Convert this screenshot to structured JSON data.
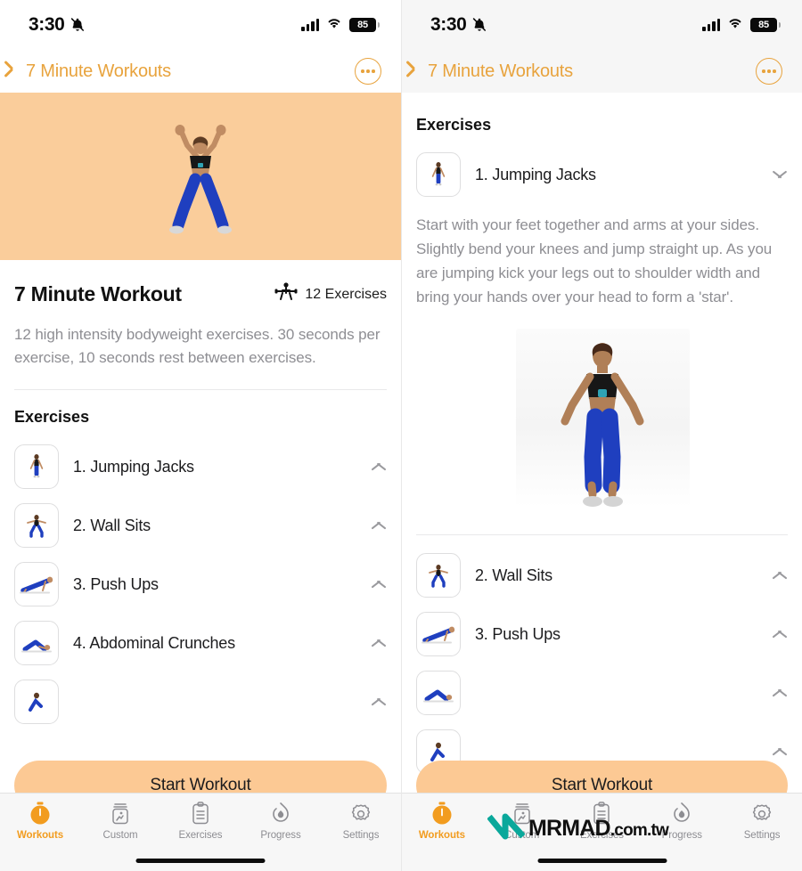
{
  "status": {
    "time": "3:30",
    "bell_icon": "bell-slash-icon",
    "signal_icon": "cellular-signal-icon",
    "wifi_icon": "wifi-icon",
    "battery_level": "85"
  },
  "nav": {
    "back_icon": "chevron-left-icon",
    "back_title": "7 Minute Workouts",
    "more_icon": "ellipsis-circle-icon"
  },
  "left": {
    "hero_bg": "#facd9b",
    "hero_icon": "jumping-jacks-photo",
    "workout_title": "7 Minute Workout",
    "count_icon": "weightlifter-icon",
    "count_label": "12 Exercises",
    "description": "12 high intensity bodyweight exercises. 30 seconds per exercise, 10 seconds rest between exercises.",
    "section_title": "Exercises",
    "exercises": [
      {
        "label": "1. Jumping Jacks",
        "chevron": "chevron-up-icon",
        "thumb": "jumping-jacks-thumb"
      },
      {
        "label": "2. Wall Sits",
        "chevron": "chevron-up-icon",
        "thumb": "wall-sits-thumb"
      },
      {
        "label": "3. Push Ups",
        "chevron": "chevron-up-icon",
        "thumb": "push-ups-thumb"
      },
      {
        "label": "4. Abdominal Crunches",
        "chevron": "chevron-up-icon",
        "thumb": "abdominal-crunches-thumb"
      }
    ],
    "start_label": "Start Workout"
  },
  "right": {
    "section_title": "Exercises",
    "expanded": {
      "label": "1. Jumping Jacks",
      "chevron": "chevron-down-icon",
      "thumb": "jumping-jacks-thumb",
      "description": "Start with your feet together and arms at your sides. Slightly bend your knees and jump straight up. As you are jumping kick your legs out to shoulder width and bring your hands over your head to form a 'star'.",
      "image": "jumping-jacks-demo-photo"
    },
    "exercises": [
      {
        "label": "2. Wall Sits",
        "chevron": "chevron-up-icon",
        "thumb": "wall-sits-thumb"
      },
      {
        "label": "3. Push Ups",
        "chevron": "chevron-up-icon",
        "thumb": "push-ups-thumb"
      }
    ],
    "start_label": "Start Workout"
  },
  "tabs": [
    {
      "label": "Workouts",
      "icon": "stopwatch-icon",
      "active": true
    },
    {
      "label": "Custom",
      "icon": "custom-workout-icon",
      "active": false
    },
    {
      "label": "Exercises",
      "icon": "clipboard-icon",
      "active": false
    },
    {
      "label": "Progress",
      "icon": "flame-icon",
      "active": false
    },
    {
      "label": "Settings",
      "icon": "gear-icon",
      "active": false
    }
  ],
  "watermark": {
    "logo_icon": "mrmad-logo-icon",
    "brand": "MRMAD",
    "domain": ".com.tw",
    "color": "#0aa89b"
  },
  "theme": {
    "accent": "#e8a33d",
    "tab_active": "#f29c1f",
    "peach": "#fcc994",
    "muted": "#8e8e93"
  }
}
